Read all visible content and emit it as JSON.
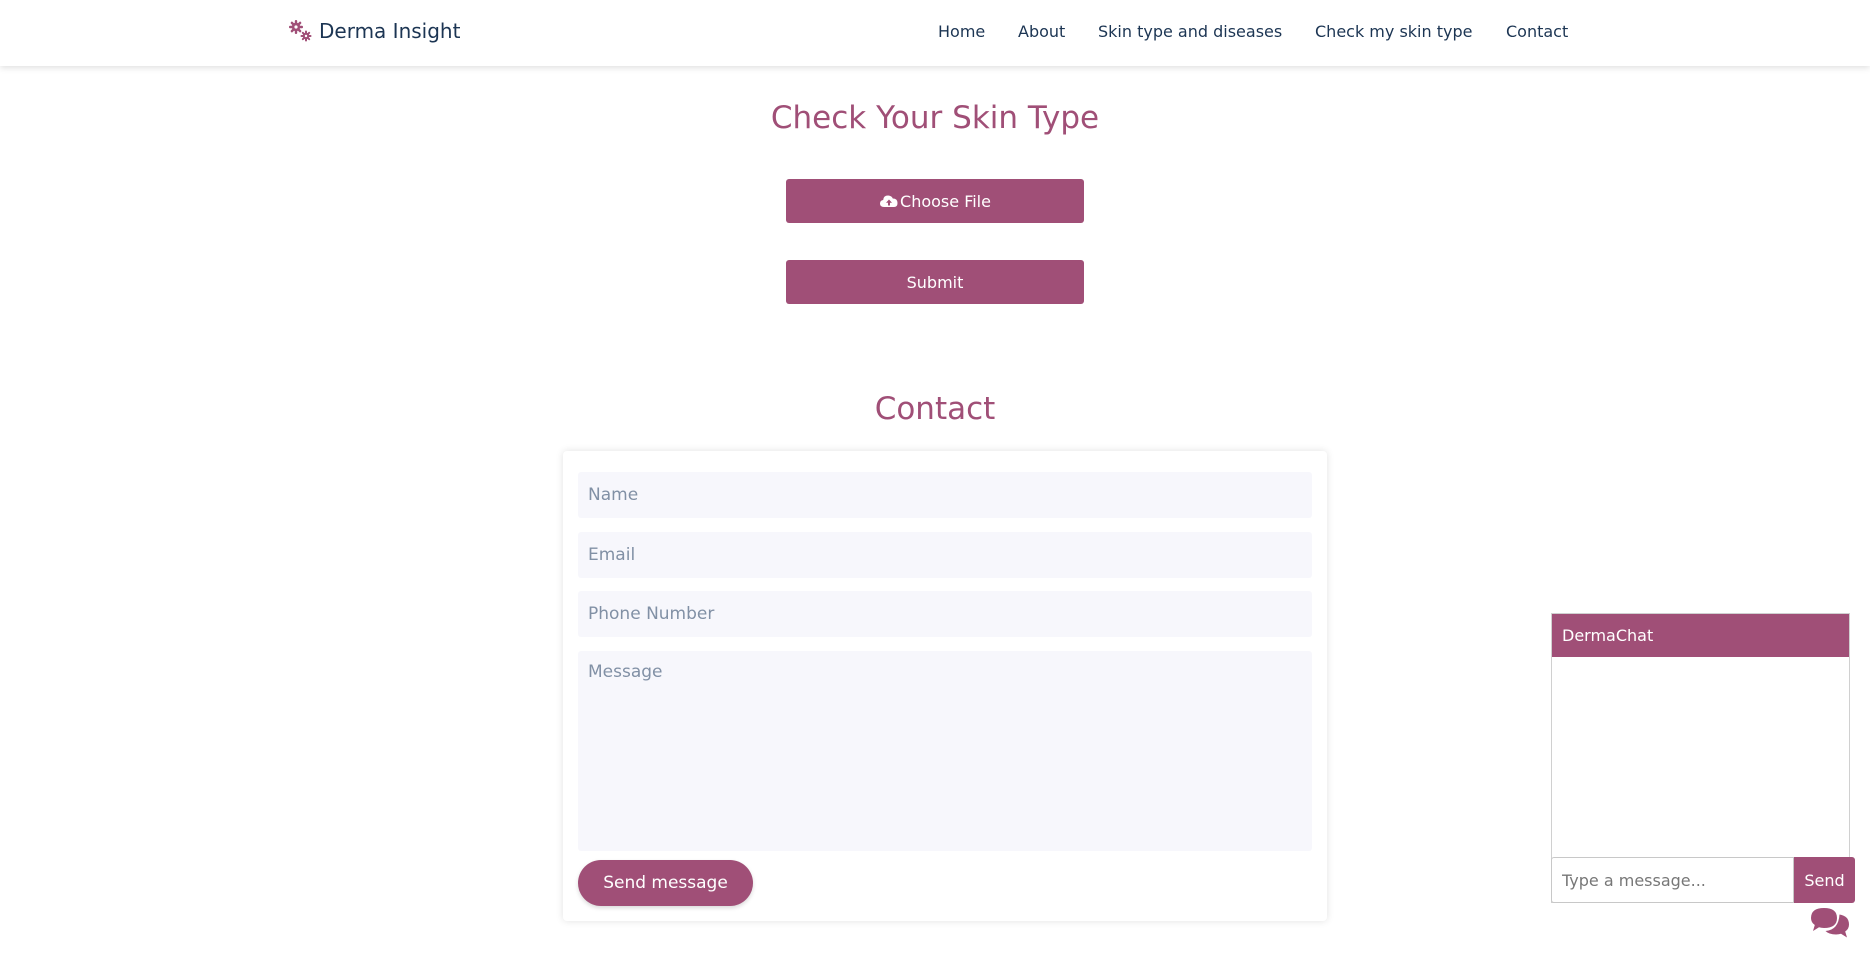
{
  "brand": {
    "name": "Derma Insight",
    "icon": "gears-icon"
  },
  "nav": {
    "items": [
      {
        "label": "Home"
      },
      {
        "label": "About"
      },
      {
        "label": "Skin type and diseases"
      },
      {
        "label": "Check my skin type"
      },
      {
        "label": "Contact"
      }
    ]
  },
  "skin_check": {
    "title": "Check Your Skin Type",
    "choose_file_label": "Choose File",
    "choose_file_icon": "cloud-upload-icon",
    "submit_label": "Submit"
  },
  "contact": {
    "title": "Contact",
    "name_placeholder": "Name",
    "email_placeholder": "Email",
    "phone_placeholder": "Phone Number",
    "message_placeholder": "Message",
    "send_label": "Send message"
  },
  "chat": {
    "title": "DermaChat",
    "input_placeholder": "Type a message...",
    "send_label": "Send",
    "toggle_icon": "chat-bubbles-icon"
  },
  "colors": {
    "accent": "#a04f77",
    "nav_text": "#1c3553",
    "field_bg": "#f7f7fc"
  }
}
